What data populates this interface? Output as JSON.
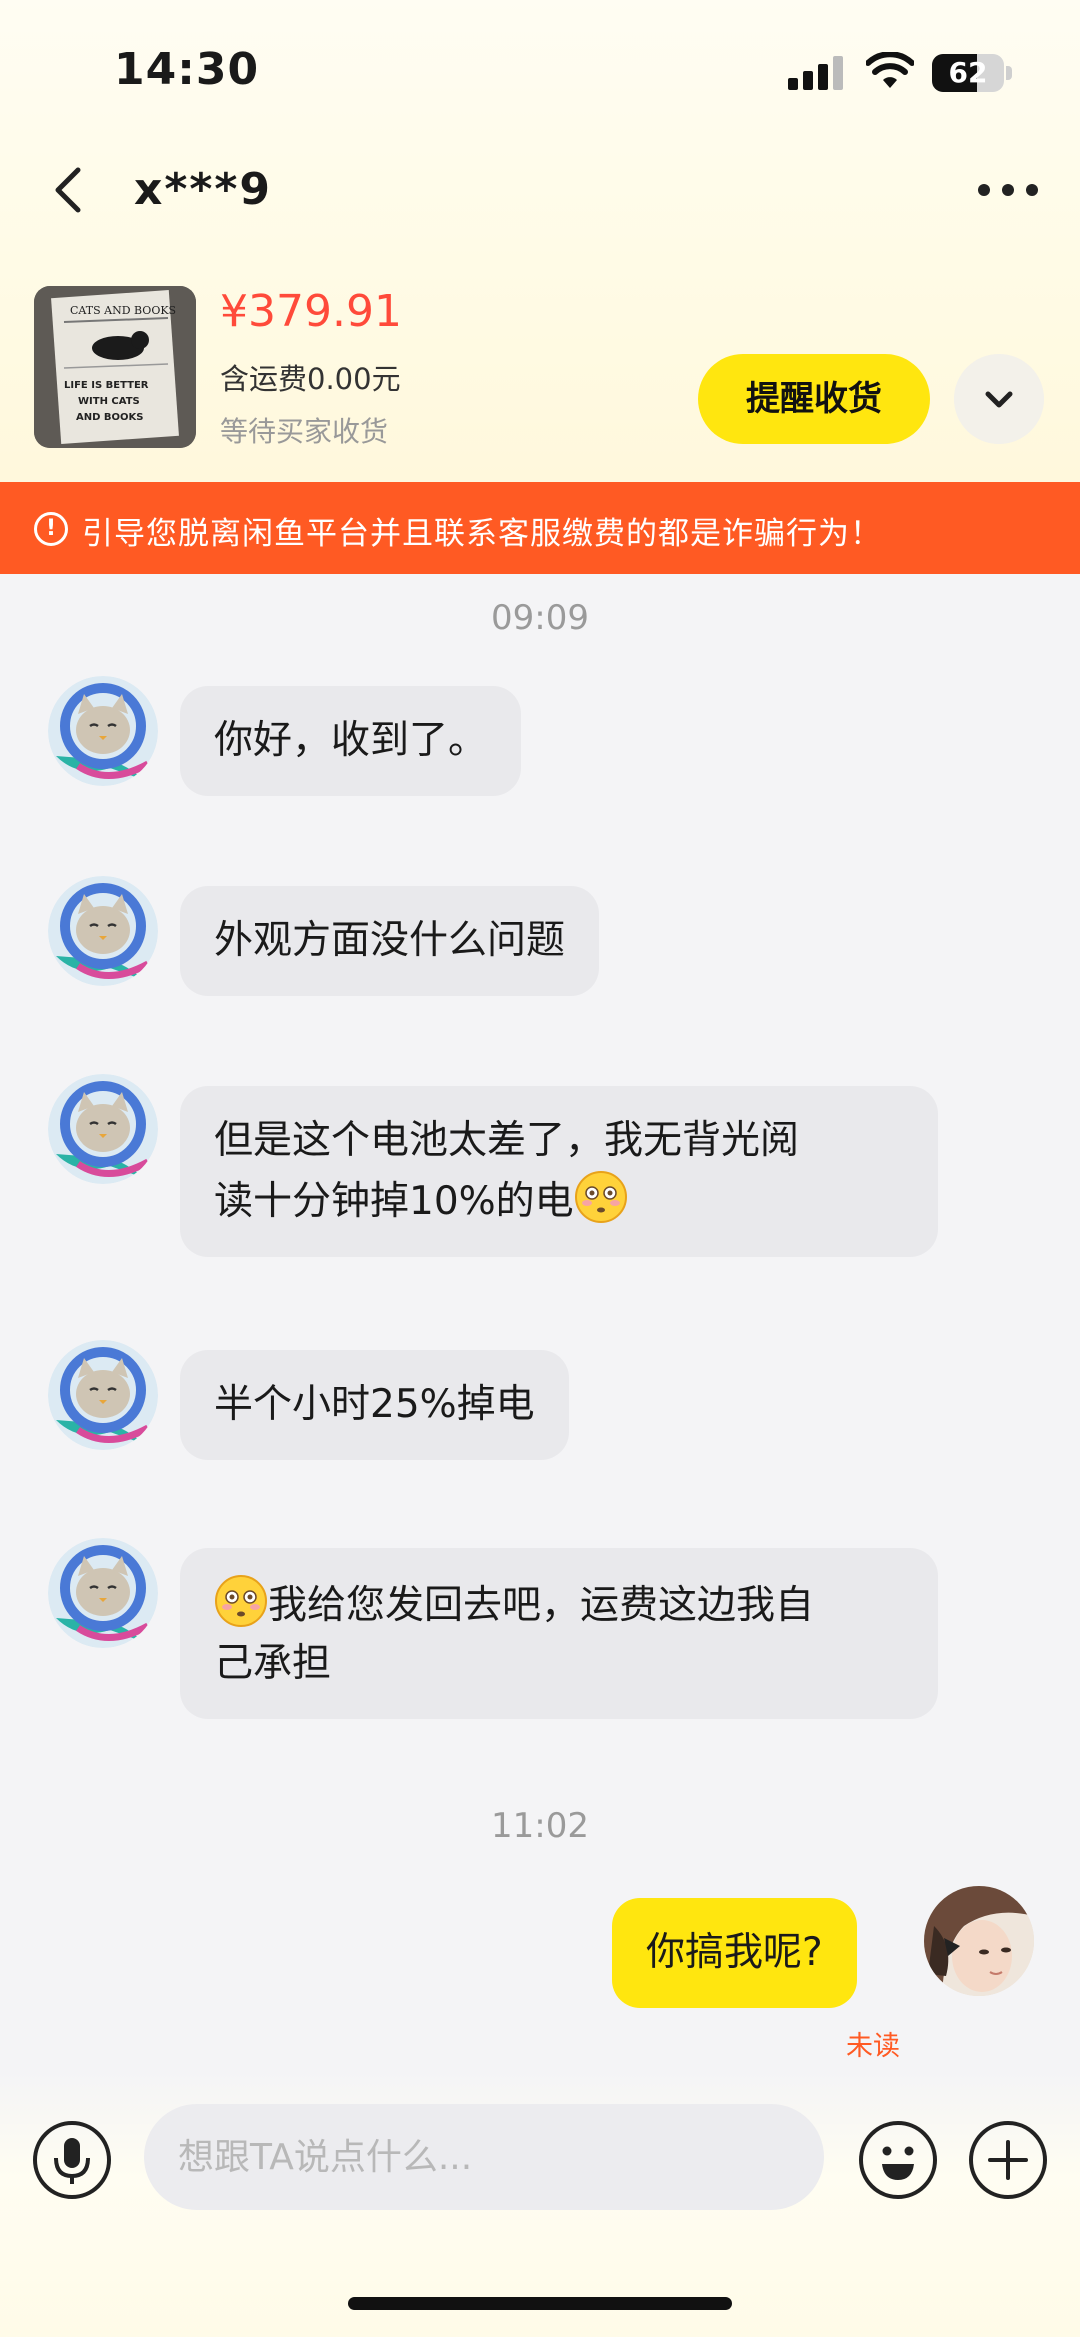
{
  "status_bar": {
    "time": "14:30",
    "battery": "62",
    "battery_level": 0.62
  },
  "nav": {
    "title": "x***9"
  },
  "product": {
    "price": "¥379.91",
    "shipping": "含运费0.00元",
    "status": "等待买家收货",
    "remind_label": "提醒收货",
    "thumbnail_text": [
      "CATS AND BOOKS",
      "LIFE IS BETTER",
      "WITH CATS",
      "AND BOOKS"
    ]
  },
  "warning": {
    "icon": "!",
    "text": "引导您脱离闲鱼平台并且联系客服缴费的都是诈骗行为！"
  },
  "chat": {
    "timestamps": [
      "09:09",
      "11:02"
    ],
    "messages": [
      {
        "sender": "other",
        "text": "你好，收到了。"
      },
      {
        "sender": "other",
        "text": "外观方面没什么问题"
      },
      {
        "sender": "other",
        "text_line1": "但是这个电池太差了，我无背光阅",
        "text_line2": "读十分钟掉10%的电",
        "emoji": "flushed-face"
      },
      {
        "sender": "other",
        "text": "半个小时25%掉电"
      },
      {
        "sender": "other",
        "emoji": "flushed-face",
        "text_line1": "我给您发回去吧，运费这边我自",
        "text_line2": "己承担"
      },
      {
        "sender": "me",
        "text": "你搞我呢?"
      }
    ],
    "unread_label": "未读"
  },
  "input": {
    "placeholder": "想跟TA说点什么..."
  },
  "colors": {
    "accent_yellow": "#ffe60f",
    "warning_orange": "#ff5a23",
    "price_red": "#ff4a3a"
  }
}
